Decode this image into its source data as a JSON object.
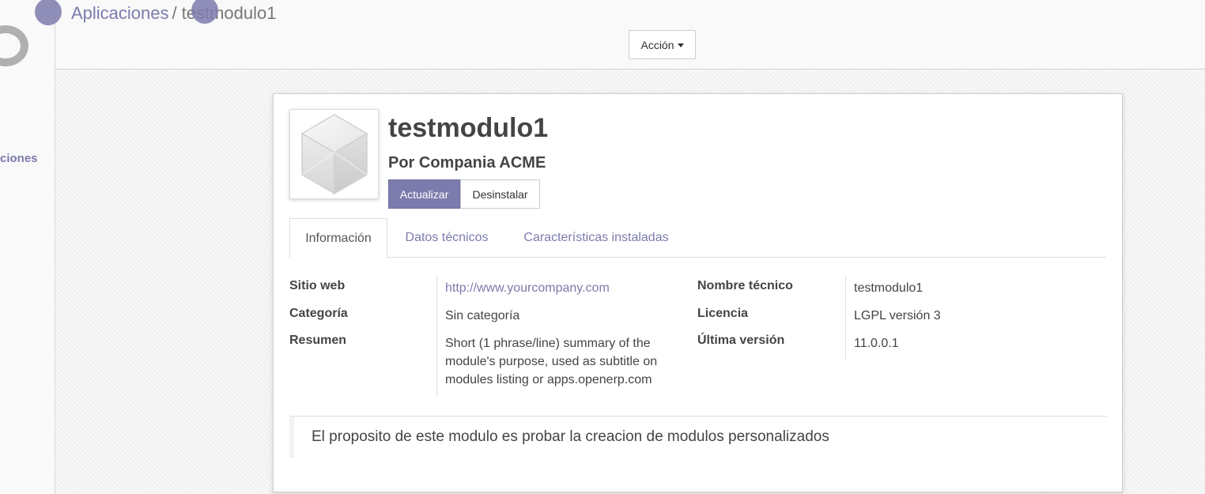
{
  "sidebar": {
    "active_menu_label": "ciones"
  },
  "breadcrumb": {
    "parent": "Aplicaciones",
    "separator": "/",
    "current": "testmodulo1"
  },
  "toolbar": {
    "action_label": "Acción"
  },
  "module": {
    "name": "testmodulo1",
    "author": "Por Compania ACME",
    "icon": "cube-icon",
    "update_label": "Actualizar",
    "uninstall_label": "Desinstalar"
  },
  "tabs": [
    {
      "label": "Información",
      "active": true
    },
    {
      "label": "Datos técnicos",
      "active": false
    },
    {
      "label": "Características instaladas",
      "active": false
    }
  ],
  "info": {
    "left": [
      {
        "label": "Sitio web",
        "value": "http://www.yourcompany.com"
      },
      {
        "label": "Categoría",
        "value": "Sin categoría"
      },
      {
        "label": "Resumen",
        "value": "Short (1 phrase/line) summary of the module's purpose, used as subtitle on modules listing or apps.openerp.com"
      }
    ],
    "right": [
      {
        "label": "Nombre técnico",
        "value": "testmodulo1"
      },
      {
        "label": "Licencia",
        "value": "LGPL versión 3"
      },
      {
        "label": "Última versión",
        "value": "11.0.0.1"
      }
    ]
  },
  "description": "El proposito de este modulo es probar la creacion de modulos personalizados",
  "colors": {
    "accent": "#7c7bad",
    "text": "#444444",
    "border": "#dddddd"
  }
}
